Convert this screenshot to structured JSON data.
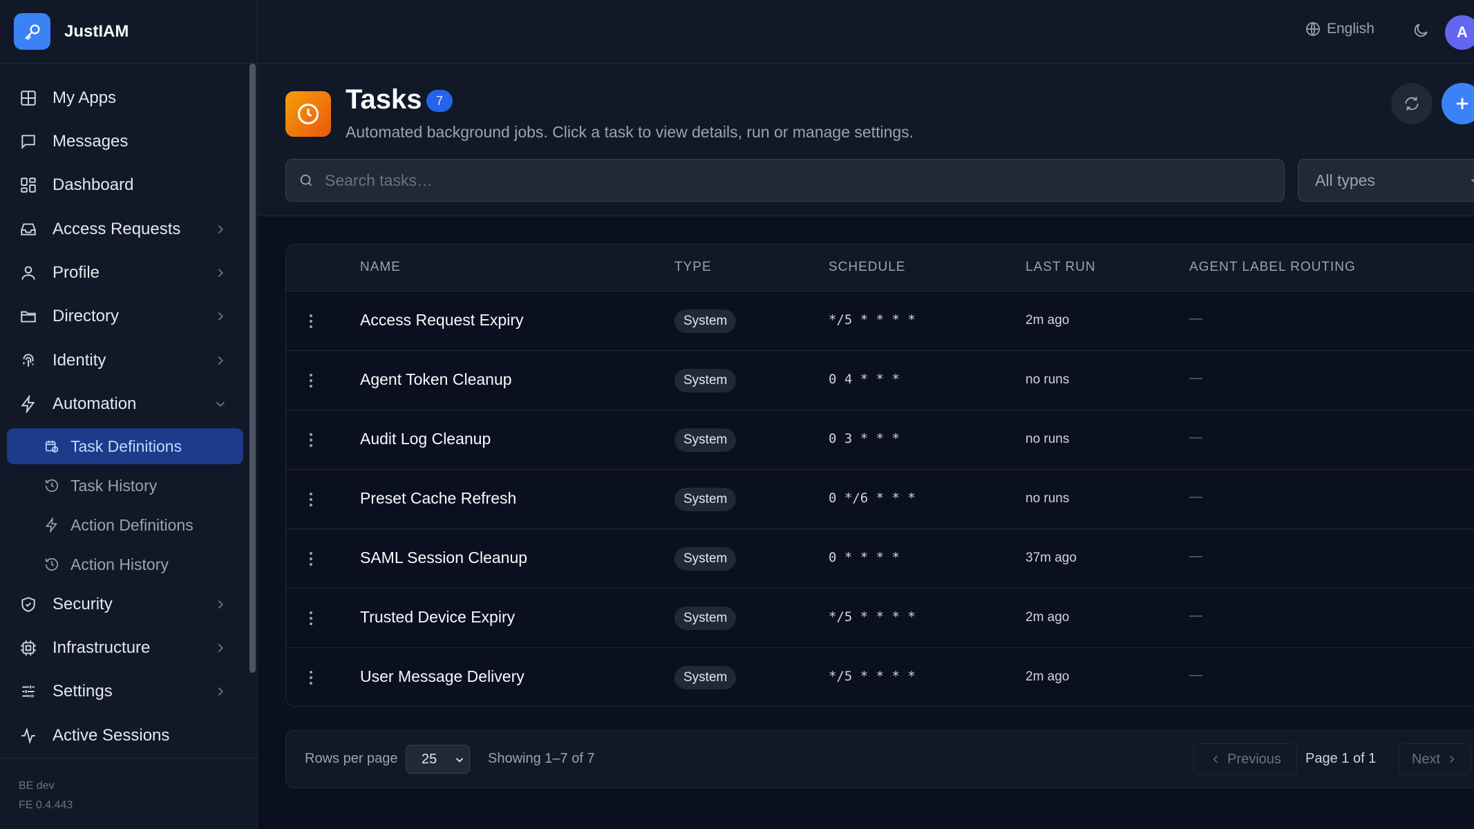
{
  "app": {
    "name": "JustIAM"
  },
  "sidebar": {
    "items": [
      {
        "label": "My Apps",
        "icon": "grid-icon"
      },
      {
        "label": "Messages",
        "icon": "message-icon"
      },
      {
        "label": "Dashboard",
        "icon": "dashboard-icon"
      },
      {
        "label": "Access Requests",
        "icon": "inbox-icon"
      },
      {
        "label": "Profile",
        "icon": "user-icon"
      },
      {
        "label": "Directory",
        "icon": "folder-icon"
      },
      {
        "label": "Identity",
        "icon": "fingerprint-icon"
      },
      {
        "label": "Automation",
        "icon": "bolt-icon"
      },
      {
        "label": "Security",
        "icon": "shield-icon"
      },
      {
        "label": "Infrastructure",
        "icon": "chip-icon"
      },
      {
        "label": "Settings",
        "icon": "sliders-icon"
      },
      {
        "label": "Active Sessions",
        "icon": "activity-icon"
      }
    ],
    "automation_sub": [
      {
        "label": "Task Definitions",
        "icon": "calendar-clock-icon",
        "active": true
      },
      {
        "label": "Task History",
        "icon": "history-icon"
      },
      {
        "label": "Action Definitions",
        "icon": "bolt-icon"
      },
      {
        "label": "Action History",
        "icon": "history-icon"
      }
    ],
    "footer": {
      "be": "BE dev",
      "fe": "FE 0.4.443"
    }
  },
  "topbar": {
    "language": "English",
    "avatar_initial": "A"
  },
  "page": {
    "title": "Tasks",
    "count": "7",
    "subtitle": "Automated background jobs. Click a task to view details, run or manage settings."
  },
  "search": {
    "placeholder": "Search tasks…",
    "value": ""
  },
  "filter": {
    "selected": "All types"
  },
  "table": {
    "columns": [
      "NAME",
      "TYPE",
      "SCHEDULE",
      "LAST RUN",
      "AGENT LABEL ROUTING"
    ],
    "rows": [
      {
        "name": "Access Request Expiry",
        "type": "System",
        "schedule": "*/5 * * * *",
        "last_run": "2m ago",
        "routing": "—"
      },
      {
        "name": "Agent Token Cleanup",
        "type": "System",
        "schedule": "0 4 * * *",
        "last_run": "no runs",
        "routing": "—"
      },
      {
        "name": "Audit Log Cleanup",
        "type": "System",
        "schedule": "0 3 * * *",
        "last_run": "no runs",
        "routing": "—"
      },
      {
        "name": "Preset Cache Refresh",
        "type": "System",
        "schedule": "0 */6 * * *",
        "last_run": "no runs",
        "routing": "—"
      },
      {
        "name": "SAML Session Cleanup",
        "type": "System",
        "schedule": "0 * * * *",
        "last_run": "37m ago",
        "routing": "—"
      },
      {
        "name": "Trusted Device Expiry",
        "type": "System",
        "schedule": "*/5 * * * *",
        "last_run": "2m ago",
        "routing": "—"
      },
      {
        "name": "User Message Delivery",
        "type": "System",
        "schedule": "*/5 * * * *",
        "last_run": "2m ago",
        "routing": "—"
      }
    ]
  },
  "pagination": {
    "rows_label": "Rows per page",
    "rows_value": "25",
    "showing": "Showing 1–7 of 7",
    "previous": "Previous",
    "page_of": "Page 1 of 1",
    "next": "Next"
  },
  "colors": {
    "accent": "#3b82f6",
    "task_icon": "#f59e0b",
    "background": "#0b1020"
  }
}
